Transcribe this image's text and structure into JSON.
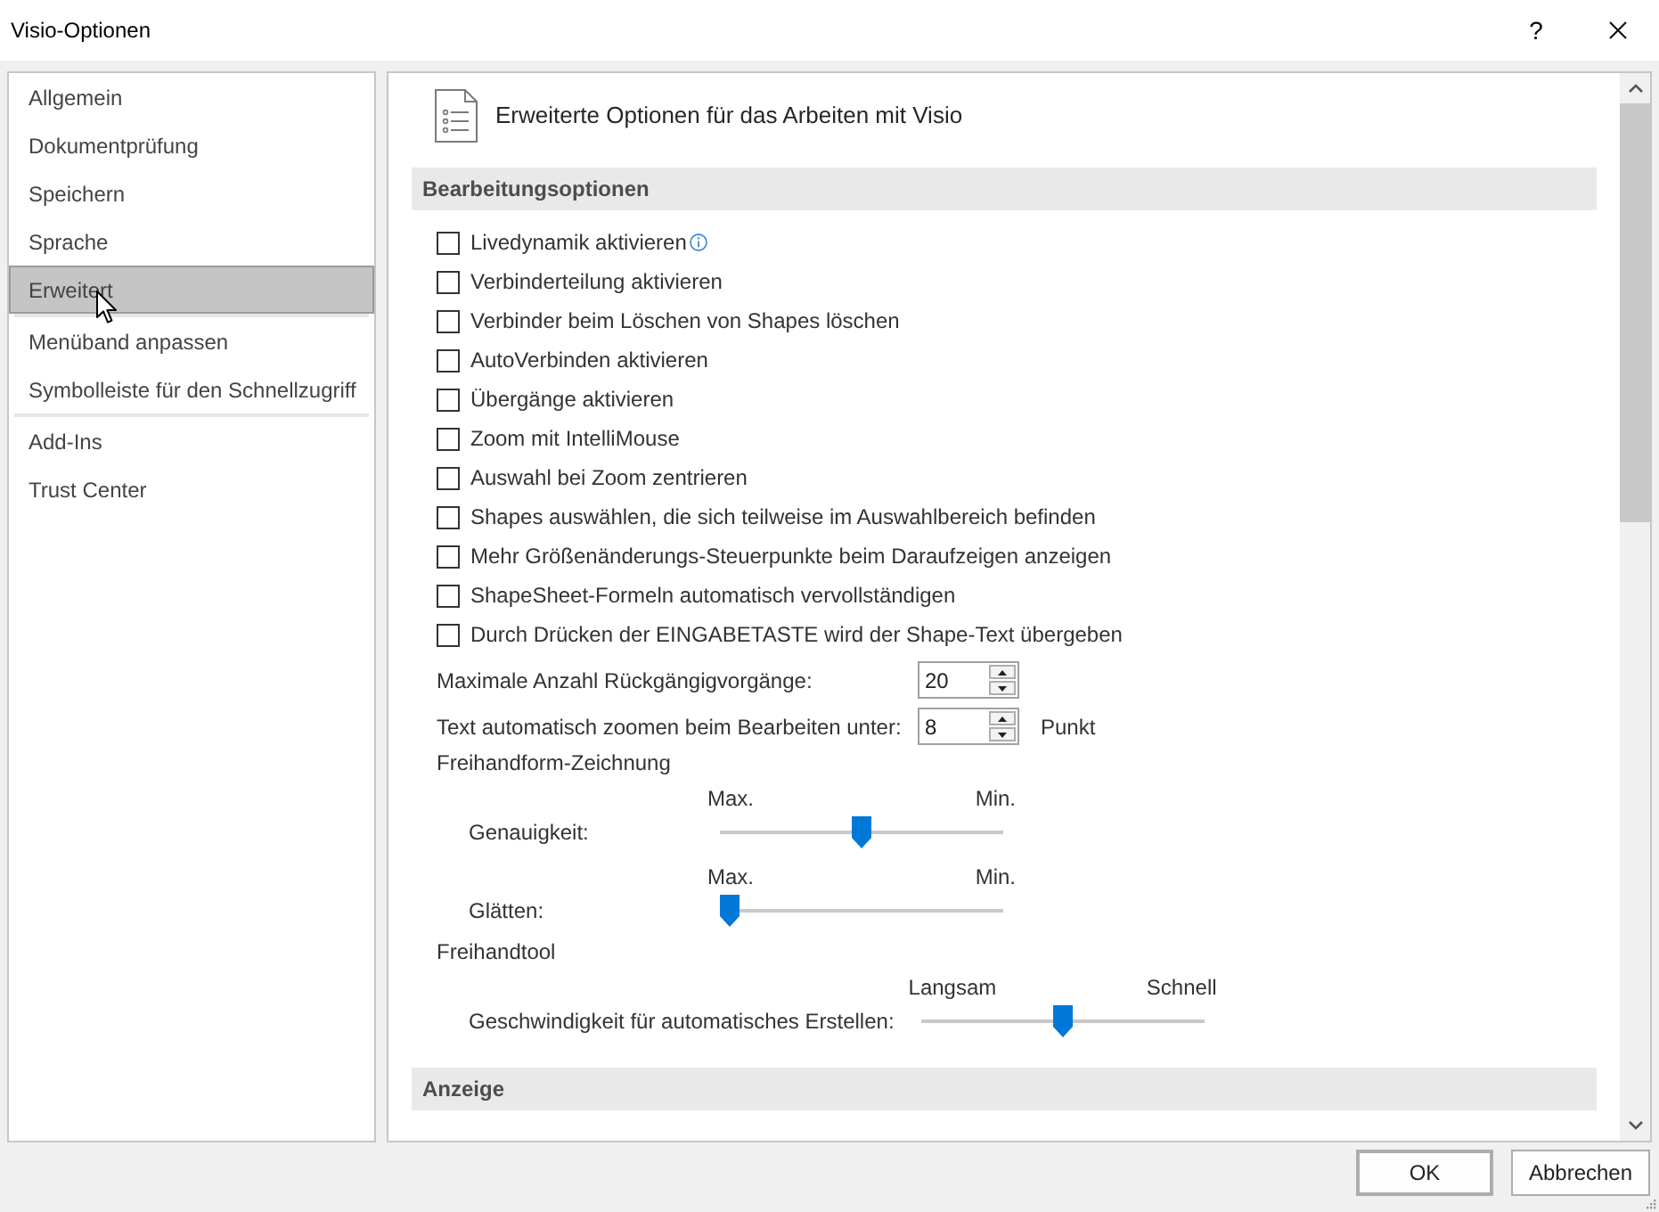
{
  "window": {
    "title": "Visio-Optionen",
    "help_label": "?"
  },
  "sidebar": {
    "groups": [
      {
        "items": [
          {
            "label": "Allgemein",
            "selected": false
          },
          {
            "label": "Dokumentprüfung",
            "selected": false
          },
          {
            "label": "Speichern",
            "selected": false
          },
          {
            "label": "Sprache",
            "selected": false
          },
          {
            "label": "Erweitert",
            "selected": true
          }
        ]
      },
      {
        "items": [
          {
            "label": "Menüband anpassen",
            "selected": false
          },
          {
            "label": "Symbolleiste für den Schnellzugriff",
            "selected": false
          }
        ]
      },
      {
        "items": [
          {
            "label": "Add-Ins",
            "selected": false
          },
          {
            "label": "Trust Center",
            "selected": false
          }
        ]
      }
    ]
  },
  "page_header": {
    "title": "Erweiterte Optionen für das Arbeiten mit Visio"
  },
  "sections": [
    {
      "title": "Bearbeitungsoptionen",
      "rows": [
        {
          "kind": "checkbox",
          "label": "Livedynamik aktivieren",
          "checked": false,
          "info": true
        },
        {
          "kind": "checkbox",
          "label": "Verbinderteilung aktivieren",
          "checked": false,
          "info": false
        },
        {
          "kind": "checkbox",
          "label": "Verbinder beim Löschen von Shapes löschen",
          "checked": false,
          "info": false
        },
        {
          "kind": "checkbox",
          "label": "AutoVerbinden aktivieren",
          "checked": false,
          "info": false
        },
        {
          "kind": "checkbox",
          "label": "Übergänge aktivieren",
          "checked": false,
          "info": false
        },
        {
          "kind": "checkbox",
          "label": "Zoom mit IntelliMouse",
          "checked": false,
          "info": false
        },
        {
          "kind": "checkbox",
          "label": "Auswahl bei Zoom zentrieren",
          "checked": false,
          "info": false
        },
        {
          "kind": "checkbox",
          "label": "Shapes auswählen, die sich teilweise im Auswahlbereich befinden",
          "checked": false,
          "info": false
        },
        {
          "kind": "checkbox",
          "label": "Mehr Größenänderungs-Steuerpunkte beim Daraufzeigen anzeigen",
          "checked": false,
          "info": false
        },
        {
          "kind": "checkbox",
          "label": "ShapeSheet-Formeln automatisch vervollständigen",
          "checked": false,
          "info": false
        },
        {
          "kind": "checkbox",
          "label": "Durch Drücken der EINGABETASTE wird der Shape-Text übergeben",
          "checked": false,
          "info": false
        },
        {
          "kind": "spin",
          "label": "Maximale Anzahl Rückgängigvorgänge:",
          "value": "20"
        },
        {
          "kind": "spin",
          "label": "Text automatisch zoomen beim Bearbeiten unter:",
          "value": "8",
          "unit": "Punkt"
        },
        {
          "kind": "heading",
          "label": "Freihandform-Zeichnung"
        },
        {
          "kind": "slider",
          "label": "Genauigkeit:",
          "left_label": "Max.",
          "right_label": "Min.",
          "level": 0.5
        },
        {
          "kind": "slider",
          "label": "Glätten:",
          "left_label": "Max.",
          "right_label": "Min.",
          "level": 0
        },
        {
          "kind": "heading",
          "label": "Freihandtool"
        },
        {
          "kind": "slider",
          "label": "Geschwindigkeit für automatisches Erstellen:",
          "left_label": "Langsam",
          "right_label": "Schnell",
          "level": 0.5
        }
      ]
    },
    {
      "title": "Anzeige"
    }
  ],
  "buttons": [
    {
      "label": "OK",
      "default": true
    },
    {
      "label": "Abbrechen",
      "default": false
    }
  ]
}
